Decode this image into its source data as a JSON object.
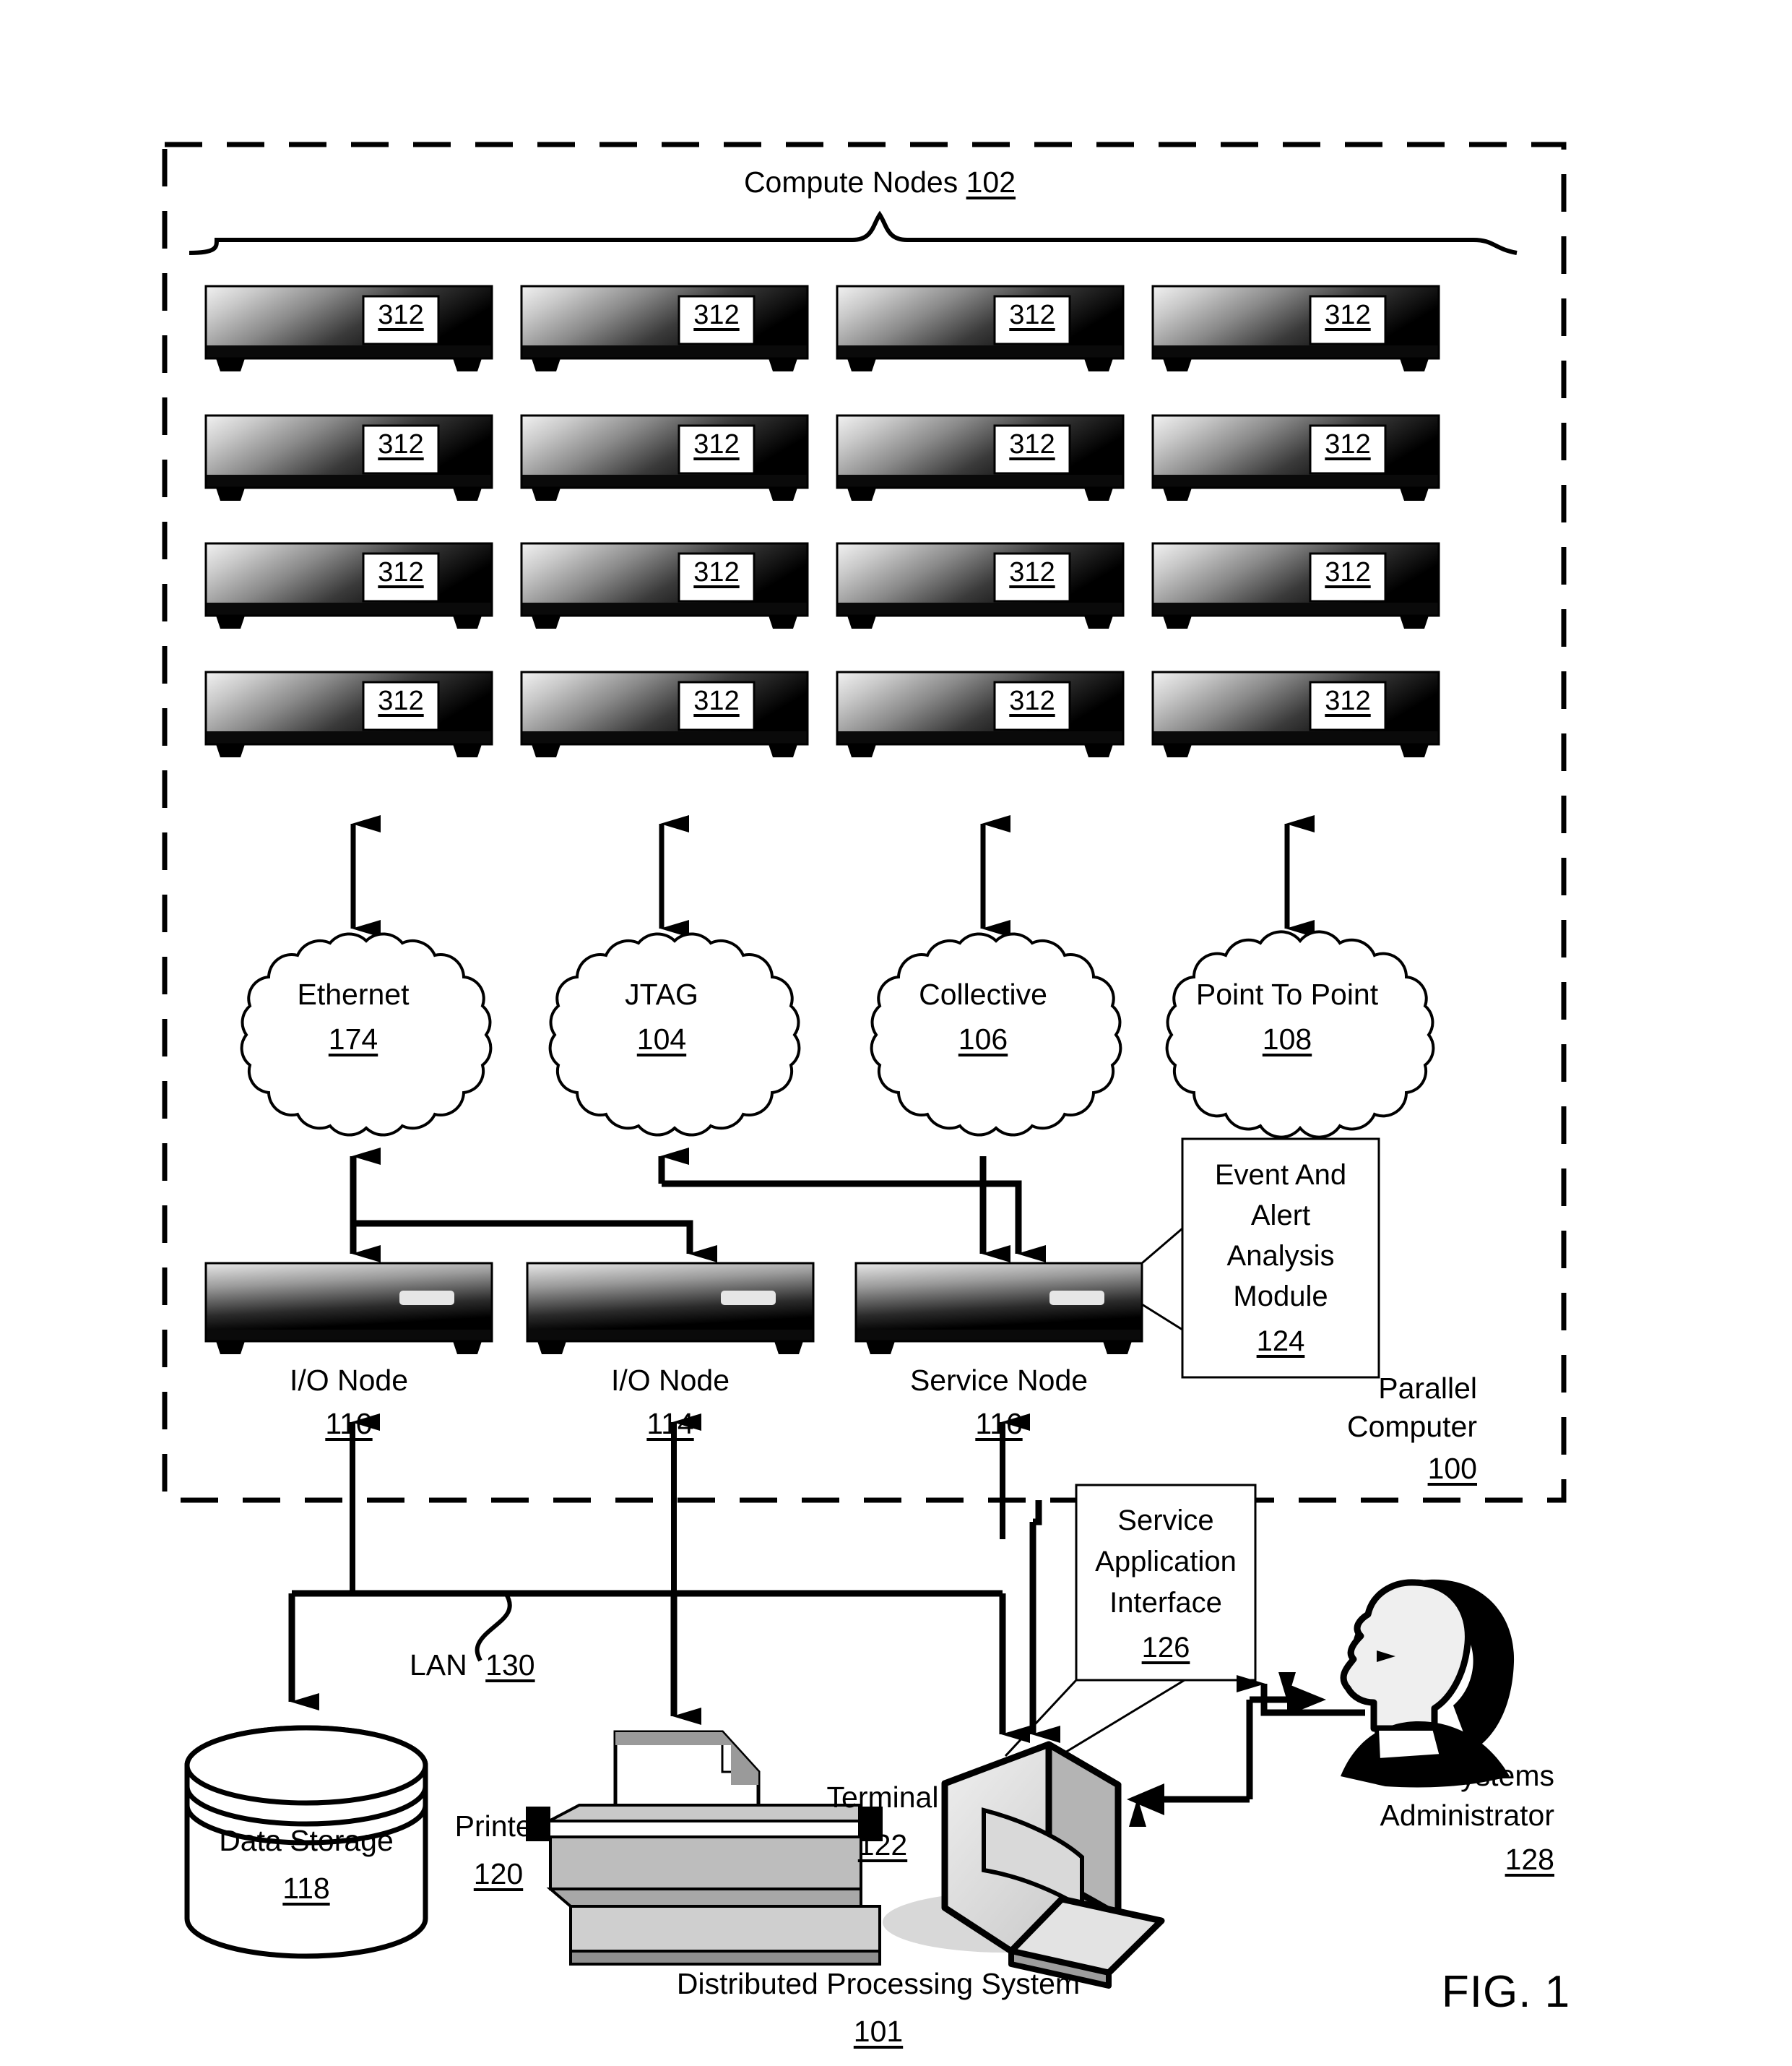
{
  "figure": {
    "number": "FIG. 1",
    "system_label": "Distributed Processing System",
    "system_ref": "101"
  },
  "parallel_computer": {
    "label_line1": "Parallel",
    "label_line2": "Computer",
    "ref": "100"
  },
  "compute_nodes": {
    "title": "Compute Nodes",
    "ref": "102",
    "node_ref": "312",
    "rows": 4,
    "cols": 4
  },
  "networks": [
    {
      "name": "Ethernet",
      "ref": "174"
    },
    {
      "name": "JTAG",
      "ref": "104"
    },
    {
      "name": "Collective",
      "ref": "106"
    },
    {
      "name": "Point To Point",
      "ref": "108"
    }
  ],
  "service_nodes": [
    {
      "name": "I/O Node",
      "ref": "110"
    },
    {
      "name": "I/O Node",
      "ref": "114"
    },
    {
      "name": "Service Node",
      "ref": "116"
    }
  ],
  "modules": {
    "event_alert": {
      "lines": [
        "Event And",
        "Alert",
        "Analysis",
        "Module"
      ],
      "ref": "124"
    },
    "service_app_interface": {
      "lines": [
        "Service",
        "Application",
        "Interface"
      ],
      "ref": "126"
    }
  },
  "lan": {
    "name": "LAN",
    "ref": "130"
  },
  "peripherals": {
    "data_storage": {
      "name": "Data Storage",
      "ref": "118"
    },
    "printer": {
      "name": "Printer",
      "ref": "120"
    },
    "terminal": {
      "name": "Terminal",
      "ref": "122"
    },
    "administrator": {
      "line1": "Systems",
      "line2": "Administrator",
      "ref": "128"
    }
  }
}
